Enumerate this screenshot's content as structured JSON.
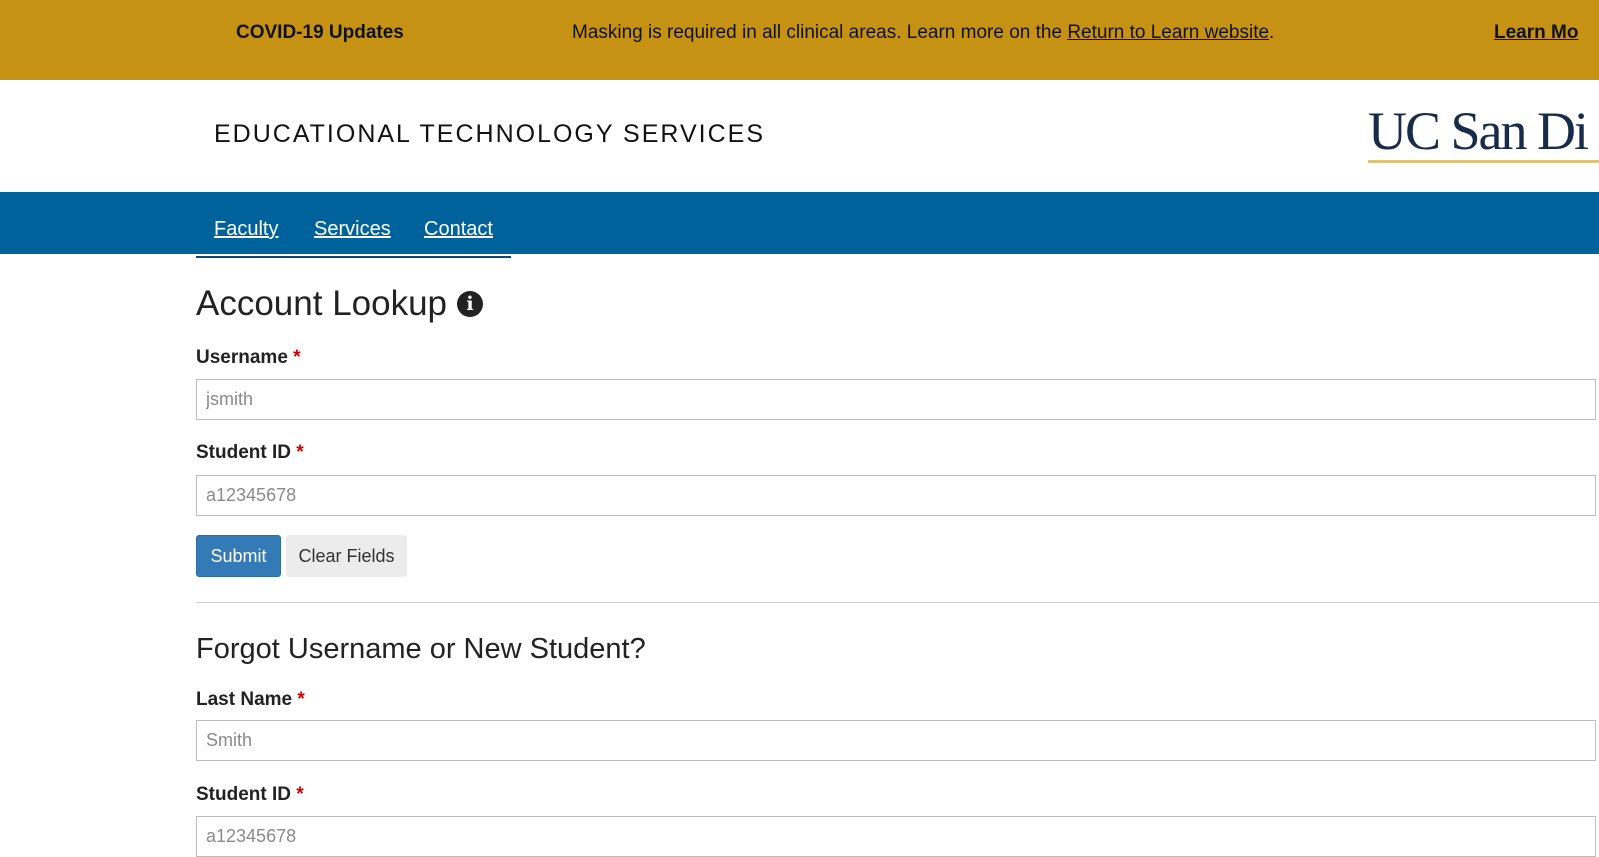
{
  "alert": {
    "title": "COVID-19 Updates",
    "message": "Masking is required in all clinical areas. Learn more on the ",
    "link_text": "Return to Learn website",
    "after_link": ".",
    "more_label": "Learn Mo"
  },
  "header": {
    "site_title": "EDUCATIONAL TECHNOLOGY SERVICES",
    "logo_text": "UC San Di"
  },
  "nav": {
    "items": [
      {
        "label": "Faculty"
      },
      {
        "label": "Services"
      },
      {
        "label": "Contact"
      }
    ]
  },
  "lookup": {
    "title": "Account Lookup",
    "info_icon": "info-circle-icon",
    "username_label": "Username",
    "username_placeholder": "jsmith",
    "student_id_label": "Student ID",
    "student_id_placeholder": "a12345678",
    "submit_label": "Submit",
    "clear_label": "Clear Fields",
    "required_mark": "*"
  },
  "forgot": {
    "title": "Forgot Username or New Student?",
    "last_name_label": "Last Name",
    "last_name_placeholder": "Smith",
    "student_id_label": "Student ID",
    "student_id_placeholder": "a12345678",
    "required_mark": "*"
  },
  "colors": {
    "alert_bg": "#c69214",
    "nav_bg": "#00629b",
    "primary_button": "#337ab7",
    "logo_navy": "#182b49",
    "required": "#d10000"
  }
}
